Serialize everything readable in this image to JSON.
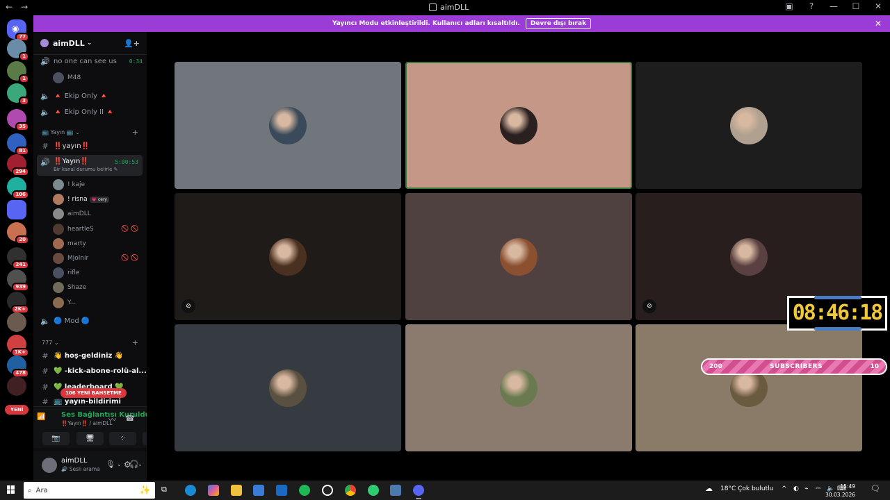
{
  "window": {
    "title": "aimDLL",
    "nav_back": "←",
    "nav_forward": "→"
  },
  "banner": {
    "text": "Yayıncı Modu etkinleştirildi. Kullanıcı adları kısaltıldı.",
    "button": "Devre dışı bırak",
    "close": "✕"
  },
  "guilds": {
    "home_badge": "77",
    "items": [
      {
        "badge": "1",
        "color": "#6b8ca8"
      },
      {
        "badge": "1",
        "color": "#5a7a48"
      },
      {
        "badge": "3",
        "color": "#3aa87a"
      },
      {
        "badge": "35",
        "color": "#b04ab0"
      },
      {
        "badge": "81",
        "color": "#3060c0"
      },
      {
        "badge": "294",
        "color": "#a02030"
      },
      {
        "badge": "106",
        "color": "#20b0a0"
      },
      {
        "badge": "",
        "color": "#5865f2"
      },
      {
        "badge": "20",
        "color": "#c87050"
      },
      {
        "badge": "241",
        "color": "#303030"
      },
      {
        "badge": "939",
        "color": "#505050"
      },
      {
        "badge": "2K+",
        "color": "#2a2a2a"
      },
      {
        "badge": "",
        "color": "#6b5a50"
      },
      {
        "badge": "1K+",
        "color": "#d04040"
      },
      {
        "badge": "478",
        "color": "#2060a0"
      },
      {
        "badge": "",
        "color": "#402020"
      }
    ],
    "new_label": "YENİ"
  },
  "sidebar": {
    "server_name": "aimDLL",
    "channels": [
      {
        "name": "no one can see us",
        "timer": "0:34"
      },
      {
        "name": "M48"
      },
      {
        "name": "🔺 Ekip Only 🔺"
      },
      {
        "name": "🔺 Ekip Only II 🔺"
      }
    ],
    "category_yayin": "📺 Yayın 📺",
    "text_channel_yayin": "‼️yayın‼️",
    "active_voice": {
      "name": "‼️Yayın‼️",
      "timer": "5:00:53",
      "status": "Bir kanal durumu belirle ✎"
    },
    "voice_users": [
      {
        "name": "! kaje",
        "color": "#7a8a90"
      },
      {
        "name": "! risna",
        "color": "#b07a60",
        "tag": "💗 cery"
      },
      {
        "name": "aimDLL",
        "color": "#8a8a8a"
      },
      {
        "name": "heartleS",
        "color": "#503a30",
        "extra": "🚫 🚫"
      },
      {
        "name": "marty",
        "color": "#a06a50"
      },
      {
        "name": "Mjolnir",
        "color": "#6a4a40",
        "extra": "🚫 🚫"
      },
      {
        "name": "rifle",
        "color": "#4a5060"
      },
      {
        "name": "Shaze",
        "color": "#706a5a"
      },
      {
        "name": "Y...",
        "color": "#8a6a50"
      }
    ],
    "mod_channel": "🔵 Mod 🔵",
    "category_777": "777",
    "text_channels": [
      "👋 hoş-geldiniz 👋",
      "💚 -kick-abone-rolü-al...",
      "💚 leaderboard 💚",
      "📺 yayın-bildirimi"
    ],
    "mention_pill": "106 YENİ BAHSETME"
  },
  "rtc": {
    "status": "Ses Bağlantısı Kuruldu",
    "sub": "‼️Yayın‼️ / aimDLL"
  },
  "userbar": {
    "name": "aimDLL",
    "status": "🔊 Sesli arama"
  },
  "tiles": [
    {
      "bg": "#70767b",
      "avatar": "#3a4a5a",
      "speaking": false,
      "muted": false
    },
    {
      "bg": "#c59786",
      "avatar": "#2a2020",
      "speaking": true,
      "muted": false
    },
    {
      "bg": "#1d1d1d",
      "avatar": "#b0a090",
      "speaking": false,
      "muted": false
    },
    {
      "bg": "#1f1b19",
      "avatar": "#4a3020",
      "speaking": false,
      "muted": true
    },
    {
      "bg": "#504141",
      "avatar": "#8a5030",
      "speaking": false,
      "muted": false
    },
    {
      "bg": "#281e1e",
      "avatar": "#5a4040",
      "speaking": false,
      "muted": true
    },
    {
      "bg": "#363b42",
      "avatar": "#5a5040",
      "speaking": false,
      "muted": false
    },
    {
      "bg": "#8a7b6e",
      "avatar": "#6a7a50",
      "speaking": false,
      "muted": false
    },
    {
      "bg": "#8a7a68",
      "avatar": "#6a5a40",
      "speaking": false,
      "muted": false
    }
  ],
  "overlay": {
    "clock": "08:46:18",
    "subs_left": "200",
    "subs_label": "SUBSCRIBERS",
    "subs_right": "10"
  },
  "taskbar": {
    "search_placeholder": "Ara",
    "weather": "18°C  Çok bulutlu",
    "time": "15:49",
    "date": "30.03.2026"
  }
}
